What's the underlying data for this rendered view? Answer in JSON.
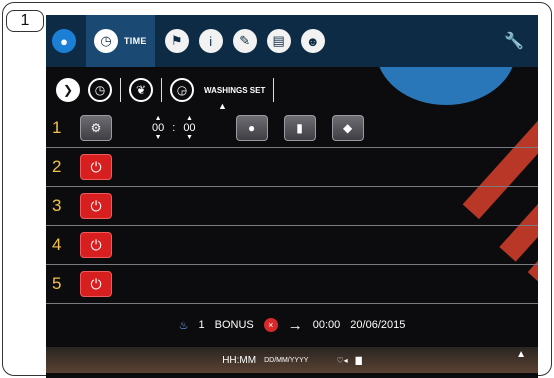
{
  "step_badge": "1",
  "topbar": {
    "time_tab_label": "TIME",
    "icons": [
      "water-drop-icon",
      "clock-icon",
      "flag-icon",
      "info-icon",
      "pencil-icon",
      "document-icon",
      "user-computer-icon",
      "wrench-icon"
    ],
    "brand_color": "#0d2b44",
    "active_tab_color": "#1a4a74"
  },
  "subbar": {
    "washings_set_label": "WASHINGS SET"
  },
  "rows": [
    {
      "num": "1",
      "hours": "00",
      "minutes": "00",
      "colon": ":"
    },
    {
      "num": "2"
    },
    {
      "num": "3"
    },
    {
      "num": "4"
    },
    {
      "num": "5"
    }
  ],
  "bonus_bar": {
    "count": "1",
    "label": "BONUS",
    "x_glyph": "×",
    "arrow": "→",
    "next_time": "00:00",
    "next_date": "20/06/2015"
  },
  "bottom_bar": {
    "time_format": "HH:MM",
    "date_format": "DD/MM/YYYY"
  },
  "colors": {
    "row_number": "#f2c14a",
    "power_button": "#d81f1f"
  }
}
